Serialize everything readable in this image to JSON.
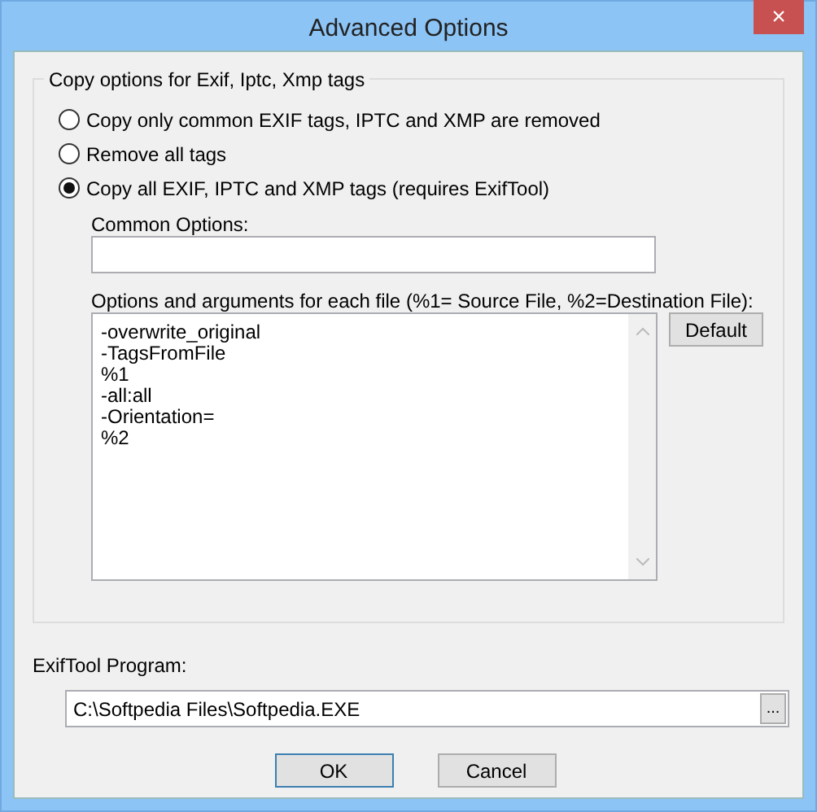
{
  "window": {
    "title": "Advanced Options",
    "close": "×"
  },
  "copy_options": {
    "legend": "Copy options for Exif, Iptc, Xmp tags",
    "radios": [
      {
        "label": "Copy only common EXIF tags, IPTC and XMP are removed",
        "selected": false
      },
      {
        "label": "Remove all tags",
        "selected": false
      },
      {
        "label": "Copy all EXIF, IPTC and XMP tags (requires ExifTool)",
        "selected": true
      }
    ],
    "common_options": {
      "label": "Common Options:"
    },
    "arguments": {
      "label": "Options and arguments for each file (%1= Source File, %2=Destination File):",
      "lines": [
        "-overwrite_original",
        "-TagsFromFile",
        "%1",
        "-all:all",
        "-Orientation=",
        "%2"
      ],
      "default_button": "Default"
    }
  },
  "exiftool": {
    "label": "ExifTool Program:",
    "value": "C:\\Softpedia Files\\Softpedia.EXE",
    "browse_button": "..."
  },
  "buttons": [
    {
      "label": "OK",
      "kind": "default"
    },
    {
      "label": "Cancel",
      "kind": "normal"
    }
  ]
}
